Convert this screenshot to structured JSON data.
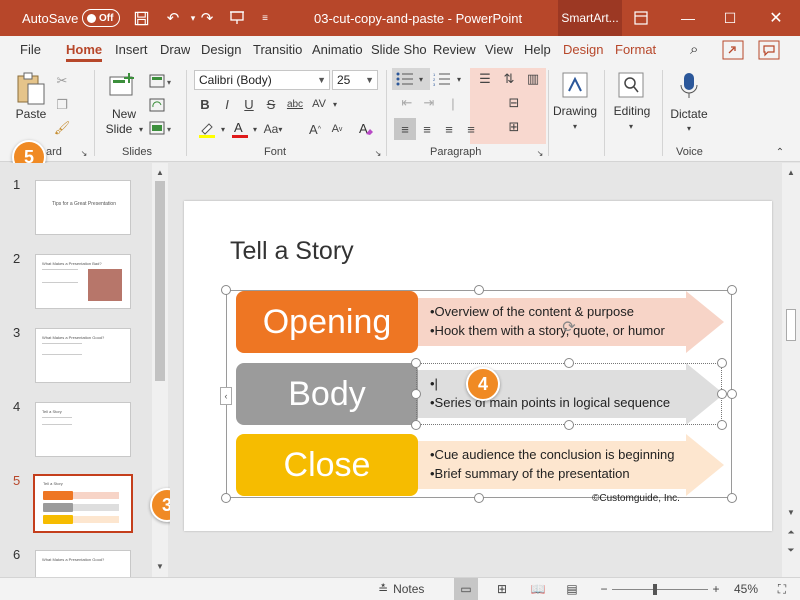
{
  "titlebar": {
    "autosave_label": "AutoSave",
    "autosave_state": "Off",
    "document_title": "03-cut-copy-and-paste - PowerPoint",
    "context_tab": "SmartArt..."
  },
  "tabs": [
    "File",
    "Home",
    "Insert",
    "Draw",
    "Design",
    "Transitio",
    "Animatio",
    "Slide Sho",
    "Review",
    "View",
    "Help",
    "Design",
    "Format"
  ],
  "ribbon": {
    "clipboard": {
      "paste_label": "Paste",
      "group_label": "ard"
    },
    "slides": {
      "new_slide_label_1": "New",
      "new_slide_label_2": "Slide",
      "group_label": "Slides"
    },
    "font": {
      "font_name": "Calibri (Body)",
      "font_size": "25",
      "group_label": "Font",
      "bold": "B",
      "italic": "I",
      "underline": "U",
      "strike": "S",
      "shadow": "abc",
      "spacing": "AV",
      "grow": "A",
      "shrink": "A",
      "case": "Aa",
      "clear": "A"
    },
    "paragraph": {
      "group_label": "Paragraph"
    },
    "drawing": {
      "label": "Drawing"
    },
    "editing": {
      "label": "Editing"
    },
    "voice": {
      "dictate_label": "Dictate",
      "group_label": "Voice"
    }
  },
  "callouts": {
    "paste": "5",
    "body_text": "4",
    "thumbnail": "3"
  },
  "thumbnails": [
    {
      "num": "1",
      "title": "Tips for a Great Presentation"
    },
    {
      "num": "2",
      "title": "What Makes a Presentation Bad?"
    },
    {
      "num": "3",
      "title": "What Makes a Presentation Good?"
    },
    {
      "num": "4",
      "title": "Tell a Story"
    },
    {
      "num": "5",
      "title": "Tell a Story"
    },
    {
      "num": "6",
      "title": "What Makes a Presentation Good?"
    }
  ],
  "slide": {
    "title": "Tell a Story",
    "rows": [
      {
        "label": "Opening",
        "bullets": [
          "•Overview of the content & purpose",
          "•Hook them with a story, quote, or humor"
        ],
        "box_color": "#ee7623",
        "arrow_color": "#f7d4c7"
      },
      {
        "label": "Body",
        "bullets": [
          "•|",
          "•Series of main points in logical sequence"
        ],
        "box_color": "#9b9b9b",
        "arrow_color": "#dedede"
      },
      {
        "label": "Close",
        "bullets": [
          "•Cue audience the conclusion is beginning",
          "•Brief summary of the presentation"
        ],
        "box_color": "#f6bc00",
        "arrow_color": "#fde6cf"
      }
    ],
    "copyright": "©Customguide, Inc."
  },
  "statusbar": {
    "notes_label": "Notes",
    "zoom_level": "45%",
    "zoom_fraction": 0.45
  },
  "colors": {
    "accent": "#b7472a",
    "callout": "#f08a24"
  }
}
